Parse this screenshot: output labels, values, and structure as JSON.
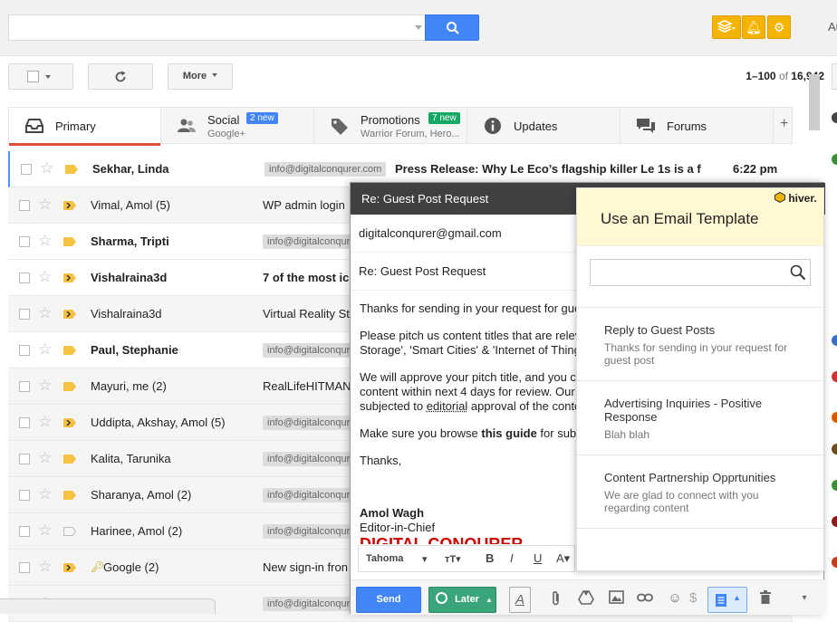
{
  "header": {
    "search_placeholder": "",
    "account_text": "Au"
  },
  "toolbar": {
    "more_label": "More",
    "pager_range": "1–100",
    "pager_of": "of",
    "pager_total": "16,942"
  },
  "tabs": [
    {
      "label": "Primary",
      "sub": "",
      "badge": "",
      "icon": "inbox-icon"
    },
    {
      "label": "Social",
      "sub": "Google+",
      "badge": "2 new",
      "badge_color": "#4285f4",
      "icon": "people-icon"
    },
    {
      "label": "Promotions",
      "sub": "Warrior Forum, Hero...",
      "badge": "7 new",
      "badge_color": "#16a765",
      "icon": "tag-icon"
    },
    {
      "label": "Updates",
      "sub": "",
      "badge": "",
      "icon": "info-icon"
    },
    {
      "label": "Forums",
      "sub": "",
      "badge": "",
      "icon": "forum-icon"
    }
  ],
  "tab_plus": "+",
  "emails": [
    {
      "sender": "Sekhar, Linda",
      "label": "info@digitalconqurer.com",
      "subject": "Press Release: Why Le Eco’s flagship killer Le 1s is a f",
      "time": "6:22 pm",
      "unread": true,
      "imp": "plain"
    },
    {
      "sender": "Vimal, Amol (5)",
      "label": "",
      "subject": "WP admin login",
      "time": "",
      "unread": false,
      "imp": "arrow"
    },
    {
      "sender": "Sharma, Tripti",
      "label": "info@digitalconqurer.com",
      "subject": "",
      "time": "",
      "unread": true,
      "imp": "plain"
    },
    {
      "sender": "Vishalraina3d",
      "label": "",
      "subject": "7 of the most ico",
      "time": "",
      "unread": true,
      "imp": "arrow"
    },
    {
      "sender": "Vishalraina3d",
      "label": "",
      "subject": "Virtual Reality Sta",
      "time": "",
      "unread": false,
      "imp": "arrow"
    },
    {
      "sender": "Paul, Stephanie",
      "label": "info@digitalconqurer.com",
      "subject": "",
      "time": "",
      "unread": true,
      "imp": "plain"
    },
    {
      "sender": "Mayuri, me (2)",
      "label": "",
      "subject": "RealLifeHITMAN",
      "time": "",
      "unread": false,
      "imp": "plain"
    },
    {
      "sender": "Uddipta, Akshay, Amol (5)",
      "label": "info@digitalconqurer.com",
      "subject": "",
      "time": "",
      "unread": false,
      "imp": "arrow"
    },
    {
      "sender": "Kalita, Tarunika",
      "label": "info@digitalconqurer.com",
      "subject": "",
      "time": "",
      "unread": false,
      "imp": "plain"
    },
    {
      "sender": "Sharanya, Amol (2)",
      "label": "info@digitalconqurer.com",
      "subject": "",
      "time": "",
      "unread": false,
      "imp": "plain"
    },
    {
      "sender": "Harinee, Amol (2)",
      "label": "info@digitalconqurer.com",
      "subject": "",
      "time": "",
      "unread": false,
      "imp": "empty"
    },
    {
      "sender": "Google (2)",
      "label": "",
      "subject": "New sign-in fron",
      "time": "",
      "unread": false,
      "imp": "arrow",
      "key_icon": true
    },
    {
      "sender": "",
      "label": "info@digitalconqurer.com",
      "subject": "",
      "time": "",
      "unread": false,
      "imp": "plain"
    }
  ],
  "compose": {
    "title": "Re: Guest Post Request",
    "to": "digitalconqurer@gmail.com",
    "subject": "Re: Guest Post Request",
    "body_1": "Thanks for sending in your request for gue",
    "body_2a": "Please pitch us content titles that are relev",
    "body_2b": "Storage', 'Smart Cities' & 'Internet of Thing",
    "body_3a": "We will approve your pitch title, and you ca",
    "body_3b": "content within next 4 days for review. Our",
    "body_3c_pre": "subjected to ",
    "body_3c_link": "editorial",
    "body_3c_post": " approval of the conte",
    "body_4_pre": "Make sure you browse ",
    "body_4_bold": "this guide",
    "body_4_post": " for subm",
    "body_5": "Thanks,",
    "sig_name": "Amol Wagh",
    "sig_title": "Editor-in-Chief",
    "sig_company": "DIGITAL CONQURER",
    "font_name": "Tahoma",
    "send_label": "Send",
    "later_label": "Later"
  },
  "hiver": {
    "logo": "hiver.",
    "title": "Use an Email Template",
    "search_placeholder": "",
    "templates": [
      {
        "title": "Reply to Guest Posts",
        "desc": "Thanks for sending in your request for guest post"
      },
      {
        "title": "Advertising Inquiries - Positive Response",
        "desc": "Blah blah"
      },
      {
        "title": "Content Partnership Opprtunities",
        "desc": "We are glad to connect with you regarding content"
      }
    ]
  },
  "colors": {
    "accent_blue": "#4285f4",
    "hiver_yellow": "#fff8d3",
    "primary_tab_red": "#dd4b39",
    "important_yellow": "#f5c342"
  }
}
